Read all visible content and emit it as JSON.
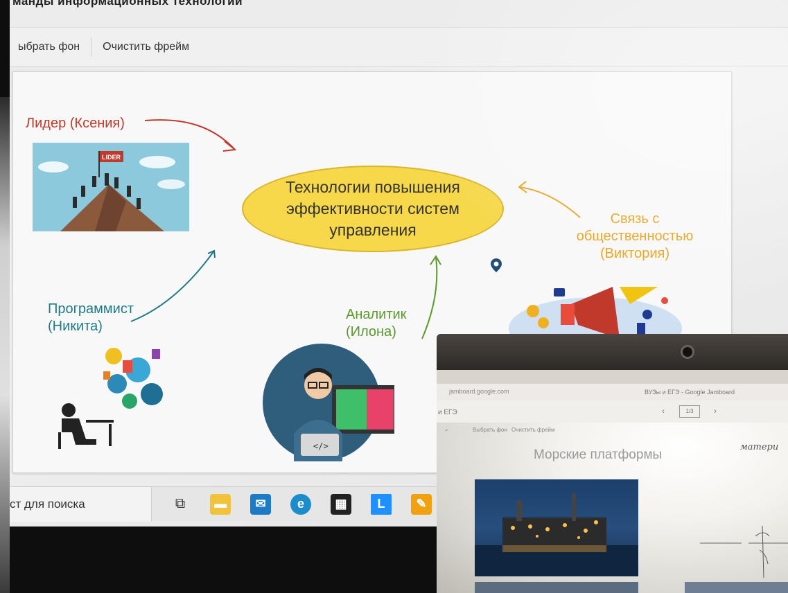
{
  "window": {
    "title": "манды информационных технологий"
  },
  "toolbar": {
    "choose_bg": "ыбрать фон",
    "clear_frame": "Очистить фрейм"
  },
  "frame": {
    "center": "Технологии повышения эффективности систем управления",
    "leader": "Лидер (Ксения)",
    "programmer": "Программист\n(Никита)",
    "analyst": "Аналитик\n(Илона)",
    "pr": "Связь с\nобщественностью\n(Виктория)",
    "leader_sign": "LIDER"
  },
  "taskbar": {
    "search_text": "ст для поиска"
  },
  "laptop": {
    "url": "jamboard.google.com",
    "tab_title": "ВУЗы и ЕГЭ - Google Jamboard",
    "board_name": "и ЕГЭ",
    "page": "1/3",
    "choose_bg": "Выбрать фон",
    "clear_frame": "Очистить фрейм",
    "heading": "Морские платформы",
    "note": "матери"
  },
  "colors": {
    "leader": "#c0392b",
    "programmer": "#1f7a86",
    "analyst": "#5a9a2a",
    "pr": "#e8a21d",
    "ellipse_fill": "#f6d84a"
  }
}
